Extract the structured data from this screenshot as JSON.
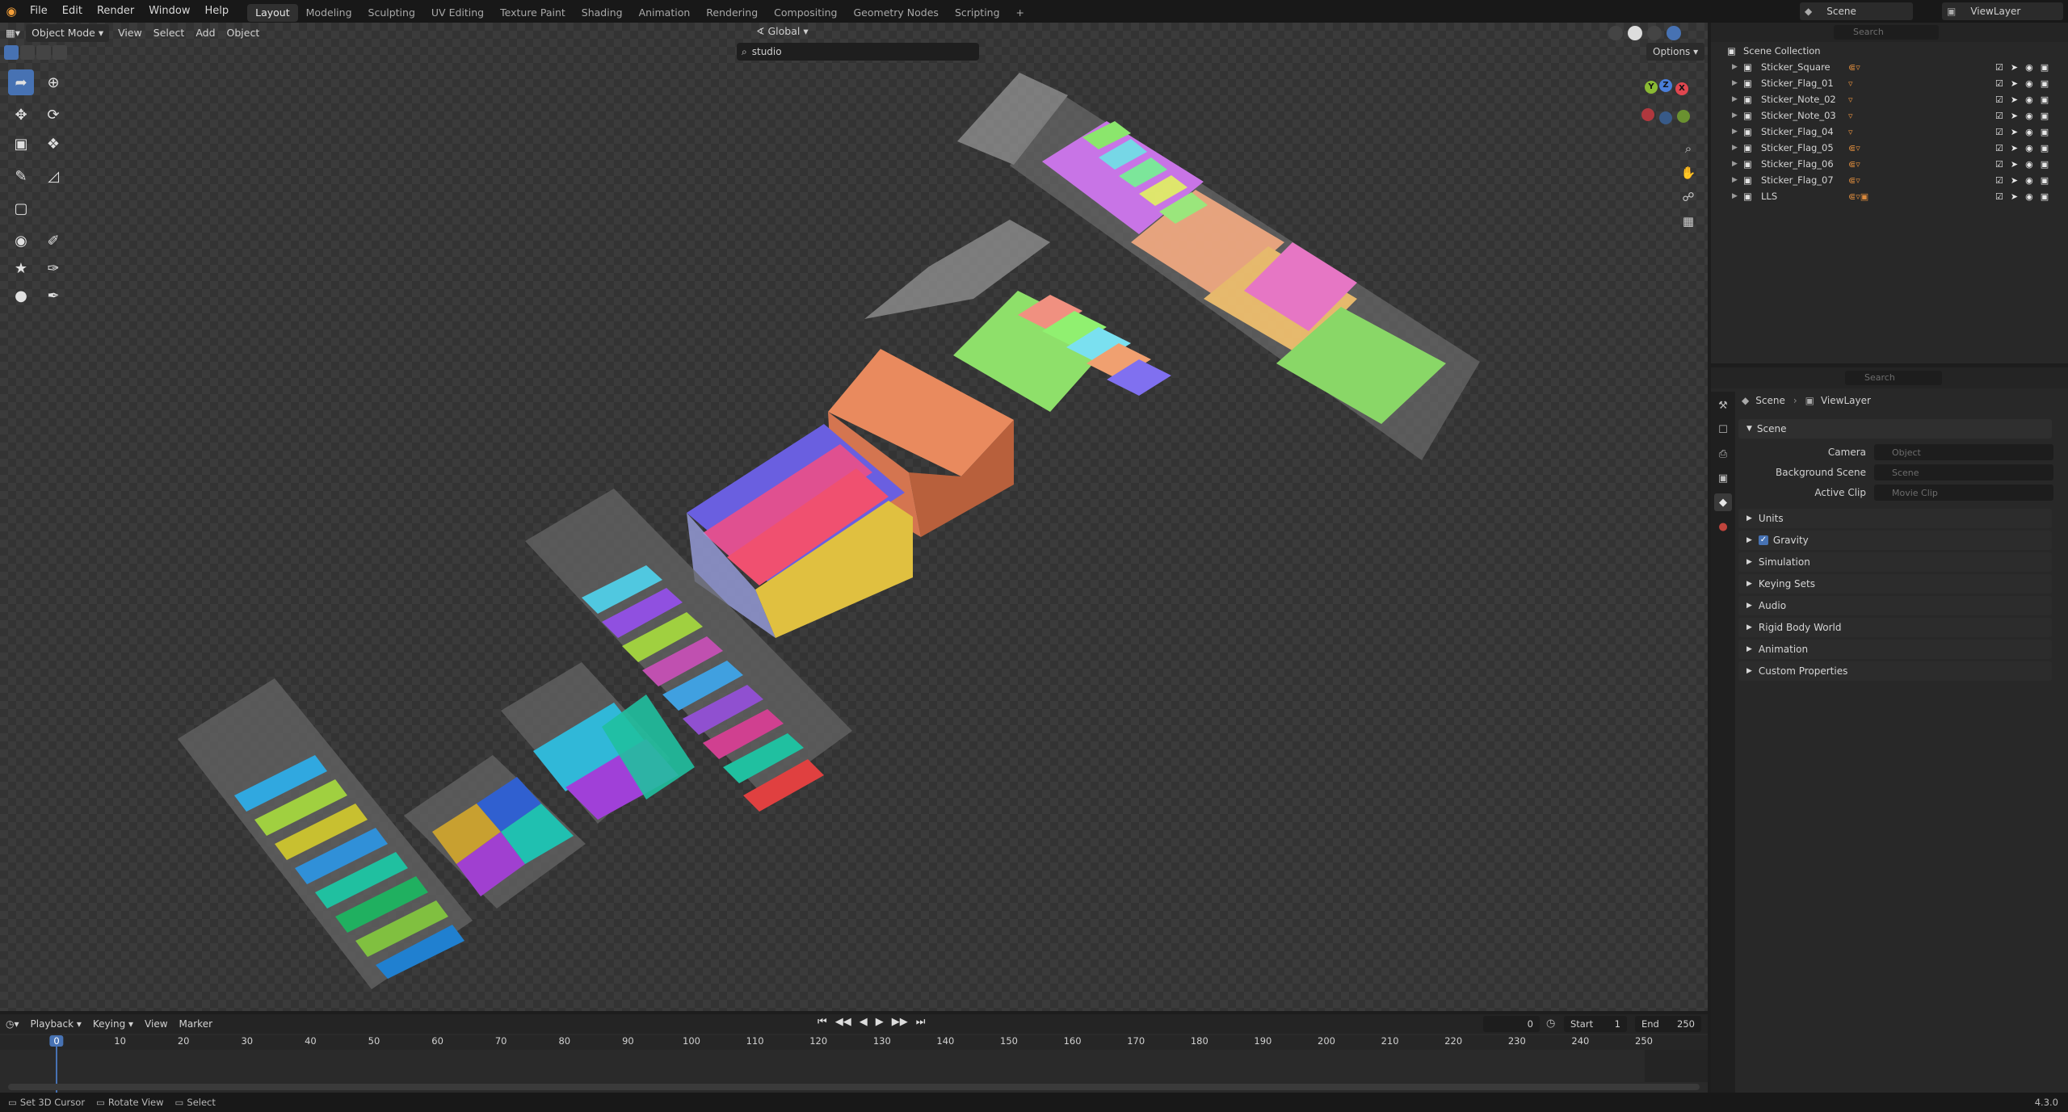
{
  "topbar": {
    "menus": [
      "File",
      "Edit",
      "Render",
      "Window",
      "Help"
    ],
    "workspaces": [
      "Layout",
      "Modeling",
      "Sculpting",
      "UV Editing",
      "Texture Paint",
      "Shading",
      "Animation",
      "Rendering",
      "Compositing",
      "Geometry Nodes",
      "Scripting"
    ],
    "active_workspace": "Layout",
    "add_tab": "+",
    "scene_label": "Scene",
    "viewlayer_label": "ViewLayer"
  },
  "viewport_header": {
    "mode": "Object Mode",
    "menus": [
      "View",
      "Select",
      "Add",
      "Object"
    ],
    "orientation": "Global",
    "search_value": "studio",
    "options_label": "Options"
  },
  "outliner": {
    "search_placeholder": "Search",
    "root": "Scene Collection",
    "items": [
      {
        "name": "Sticker_Square"
      },
      {
        "name": "Sticker_Flag_01"
      },
      {
        "name": "Sticker_Note_02"
      },
      {
        "name": "Sticker_Note_03"
      },
      {
        "name": "Sticker_Flag_04"
      },
      {
        "name": "Sticker_Flag_05"
      },
      {
        "name": "Sticker_Flag_06"
      },
      {
        "name": "Sticker_Flag_07"
      },
      {
        "name": "LLS"
      }
    ]
  },
  "properties": {
    "search_placeholder": "Search",
    "breadcrumb": [
      "Scene",
      "ViewLayer"
    ],
    "scene_section": "Scene",
    "fields": [
      {
        "label": "Camera",
        "placeholder": "Object"
      },
      {
        "label": "Background Scene",
        "placeholder": "Scene"
      },
      {
        "label": "Active Clip",
        "placeholder": "Movie Clip"
      }
    ],
    "panels": [
      "Units",
      "Gravity",
      "Simulation",
      "Keying Sets",
      "Audio",
      "Rigid Body World",
      "Animation",
      "Custom Properties"
    ],
    "gravity_checked": true
  },
  "timeline": {
    "menus": [
      "Playback",
      "Keying",
      "View",
      "Marker"
    ],
    "current_frame": "0",
    "start_label": "Start",
    "start_value": "1",
    "end_label": "End",
    "end_value": "250",
    "ticks": [
      "0",
      "10",
      "20",
      "30",
      "40",
      "50",
      "60",
      "70",
      "80",
      "90",
      "100",
      "110",
      "120",
      "130",
      "140",
      "150",
      "160",
      "170",
      "180",
      "190",
      "200",
      "210",
      "220",
      "230",
      "240",
      "250"
    ]
  },
  "statusbar": {
    "items": [
      "Set 3D Cursor",
      "Rotate View",
      "Select"
    ],
    "version": "4.3.0"
  },
  "colors": {
    "accent": "#4772b3",
    "orange": "#f29e39",
    "bg": "#3b3b3b"
  }
}
